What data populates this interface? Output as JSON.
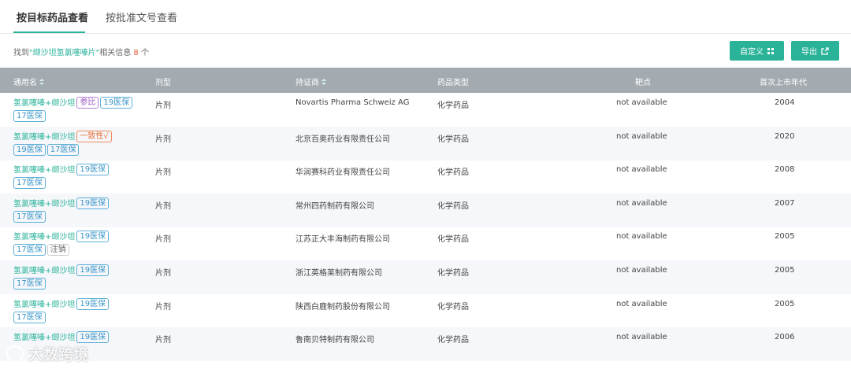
{
  "tabs": [
    {
      "label": "按目标药品查看",
      "active": true
    },
    {
      "label": "按批准文号查看",
      "active": false
    }
  ],
  "summary": {
    "prefix": "找到",
    "query": "\"缬沙坦氢氯噻嗪片\"",
    "middle": "相关信息 ",
    "count": "8",
    "suffix": " 个"
  },
  "buttons": {
    "custom": "自定义",
    "export": "导出"
  },
  "columns": {
    "name": "通用名",
    "form": "剂型",
    "holder": "持证商",
    "type": "药品类型",
    "target": "靶点",
    "year": "首次上市年代"
  },
  "rows": [
    {
      "drug": "氢氯噻嗪+缬沙坦",
      "line1_tags": [
        {
          "text": "参比",
          "color": "purple"
        },
        {
          "text": "19医保",
          "color": "blue"
        }
      ],
      "line2_tags": [
        {
          "text": "17医保",
          "color": "blue"
        }
      ],
      "form": "片剂",
      "holder": "Novartis Pharma Schweiz AG",
      "type": "化学药品",
      "target": "not available",
      "year": "2004"
    },
    {
      "drug": "氢氯噻嗪+缬沙坦",
      "line1_tags": [
        {
          "text": "一致性√",
          "color": "orange"
        }
      ],
      "line2_tags": [
        {
          "text": "19医保",
          "color": "blue"
        },
        {
          "text": "17医保",
          "color": "blue"
        }
      ],
      "form": "片剂",
      "holder": "北京百奥药业有限责任公司",
      "type": "化学药品",
      "target": "not available",
      "year": "2020"
    },
    {
      "drug": "氢氯噻嗪+缬沙坦",
      "line1_tags": [
        {
          "text": "19医保",
          "color": "blue"
        }
      ],
      "line2_tags": [
        {
          "text": "17医保",
          "color": "blue"
        }
      ],
      "form": "片剂",
      "holder": "华润赛科药业有限责任公司",
      "type": "化学药品",
      "target": "not available",
      "year": "2008"
    },
    {
      "drug": "氢氯噻嗪+缬沙坦",
      "line1_tags": [
        {
          "text": "19医保",
          "color": "blue"
        }
      ],
      "line2_tags": [
        {
          "text": "17医保",
          "color": "blue"
        }
      ],
      "form": "片剂",
      "holder": "常州四药制药有限公司",
      "type": "化学药品",
      "target": "not available",
      "year": "2007"
    },
    {
      "drug": "氢氯噻嗪+缬沙坦",
      "line1_tags": [
        {
          "text": "19医保",
          "color": "blue"
        }
      ],
      "line2_tags": [
        {
          "text": "17医保",
          "color": "blue"
        },
        {
          "text": "注销",
          "color": "gray"
        }
      ],
      "form": "片剂",
      "holder": "江苏正大丰海制药有限公司",
      "type": "化学药品",
      "target": "not available",
      "year": "2005"
    },
    {
      "drug": "氢氯噻嗪+缬沙坦",
      "line1_tags": [
        {
          "text": "19医保",
          "color": "blue"
        }
      ],
      "line2_tags": [
        {
          "text": "17医保",
          "color": "blue"
        }
      ],
      "form": "片剂",
      "holder": "浙江英格莱制药有限公司",
      "type": "化学药品",
      "target": "not available",
      "year": "2005"
    },
    {
      "drug": "氢氯噻嗪+缬沙坦",
      "line1_tags": [
        {
          "text": "19医保",
          "color": "blue"
        }
      ],
      "line2_tags": [
        {
          "text": "17医保",
          "color": "blue"
        }
      ],
      "form": "片剂",
      "holder": "陕西白鹿制药股份有限公司",
      "type": "化学药品",
      "target": "not available",
      "year": "2005"
    },
    {
      "drug": "氢氯噻嗪+缬沙坦",
      "line1_tags": [
        {
          "text": "19医保",
          "color": "blue"
        }
      ],
      "line2_tags": [],
      "form": "片剂",
      "holder": "鲁南贝特制药有限公司",
      "type": "化学药品",
      "target": "not available",
      "year": "2006"
    }
  ],
  "watermark": "大数跨境",
  "colors": {
    "accent": "#2bb39a",
    "header_bg": "#a3aab0",
    "count": "#e85a3c"
  }
}
